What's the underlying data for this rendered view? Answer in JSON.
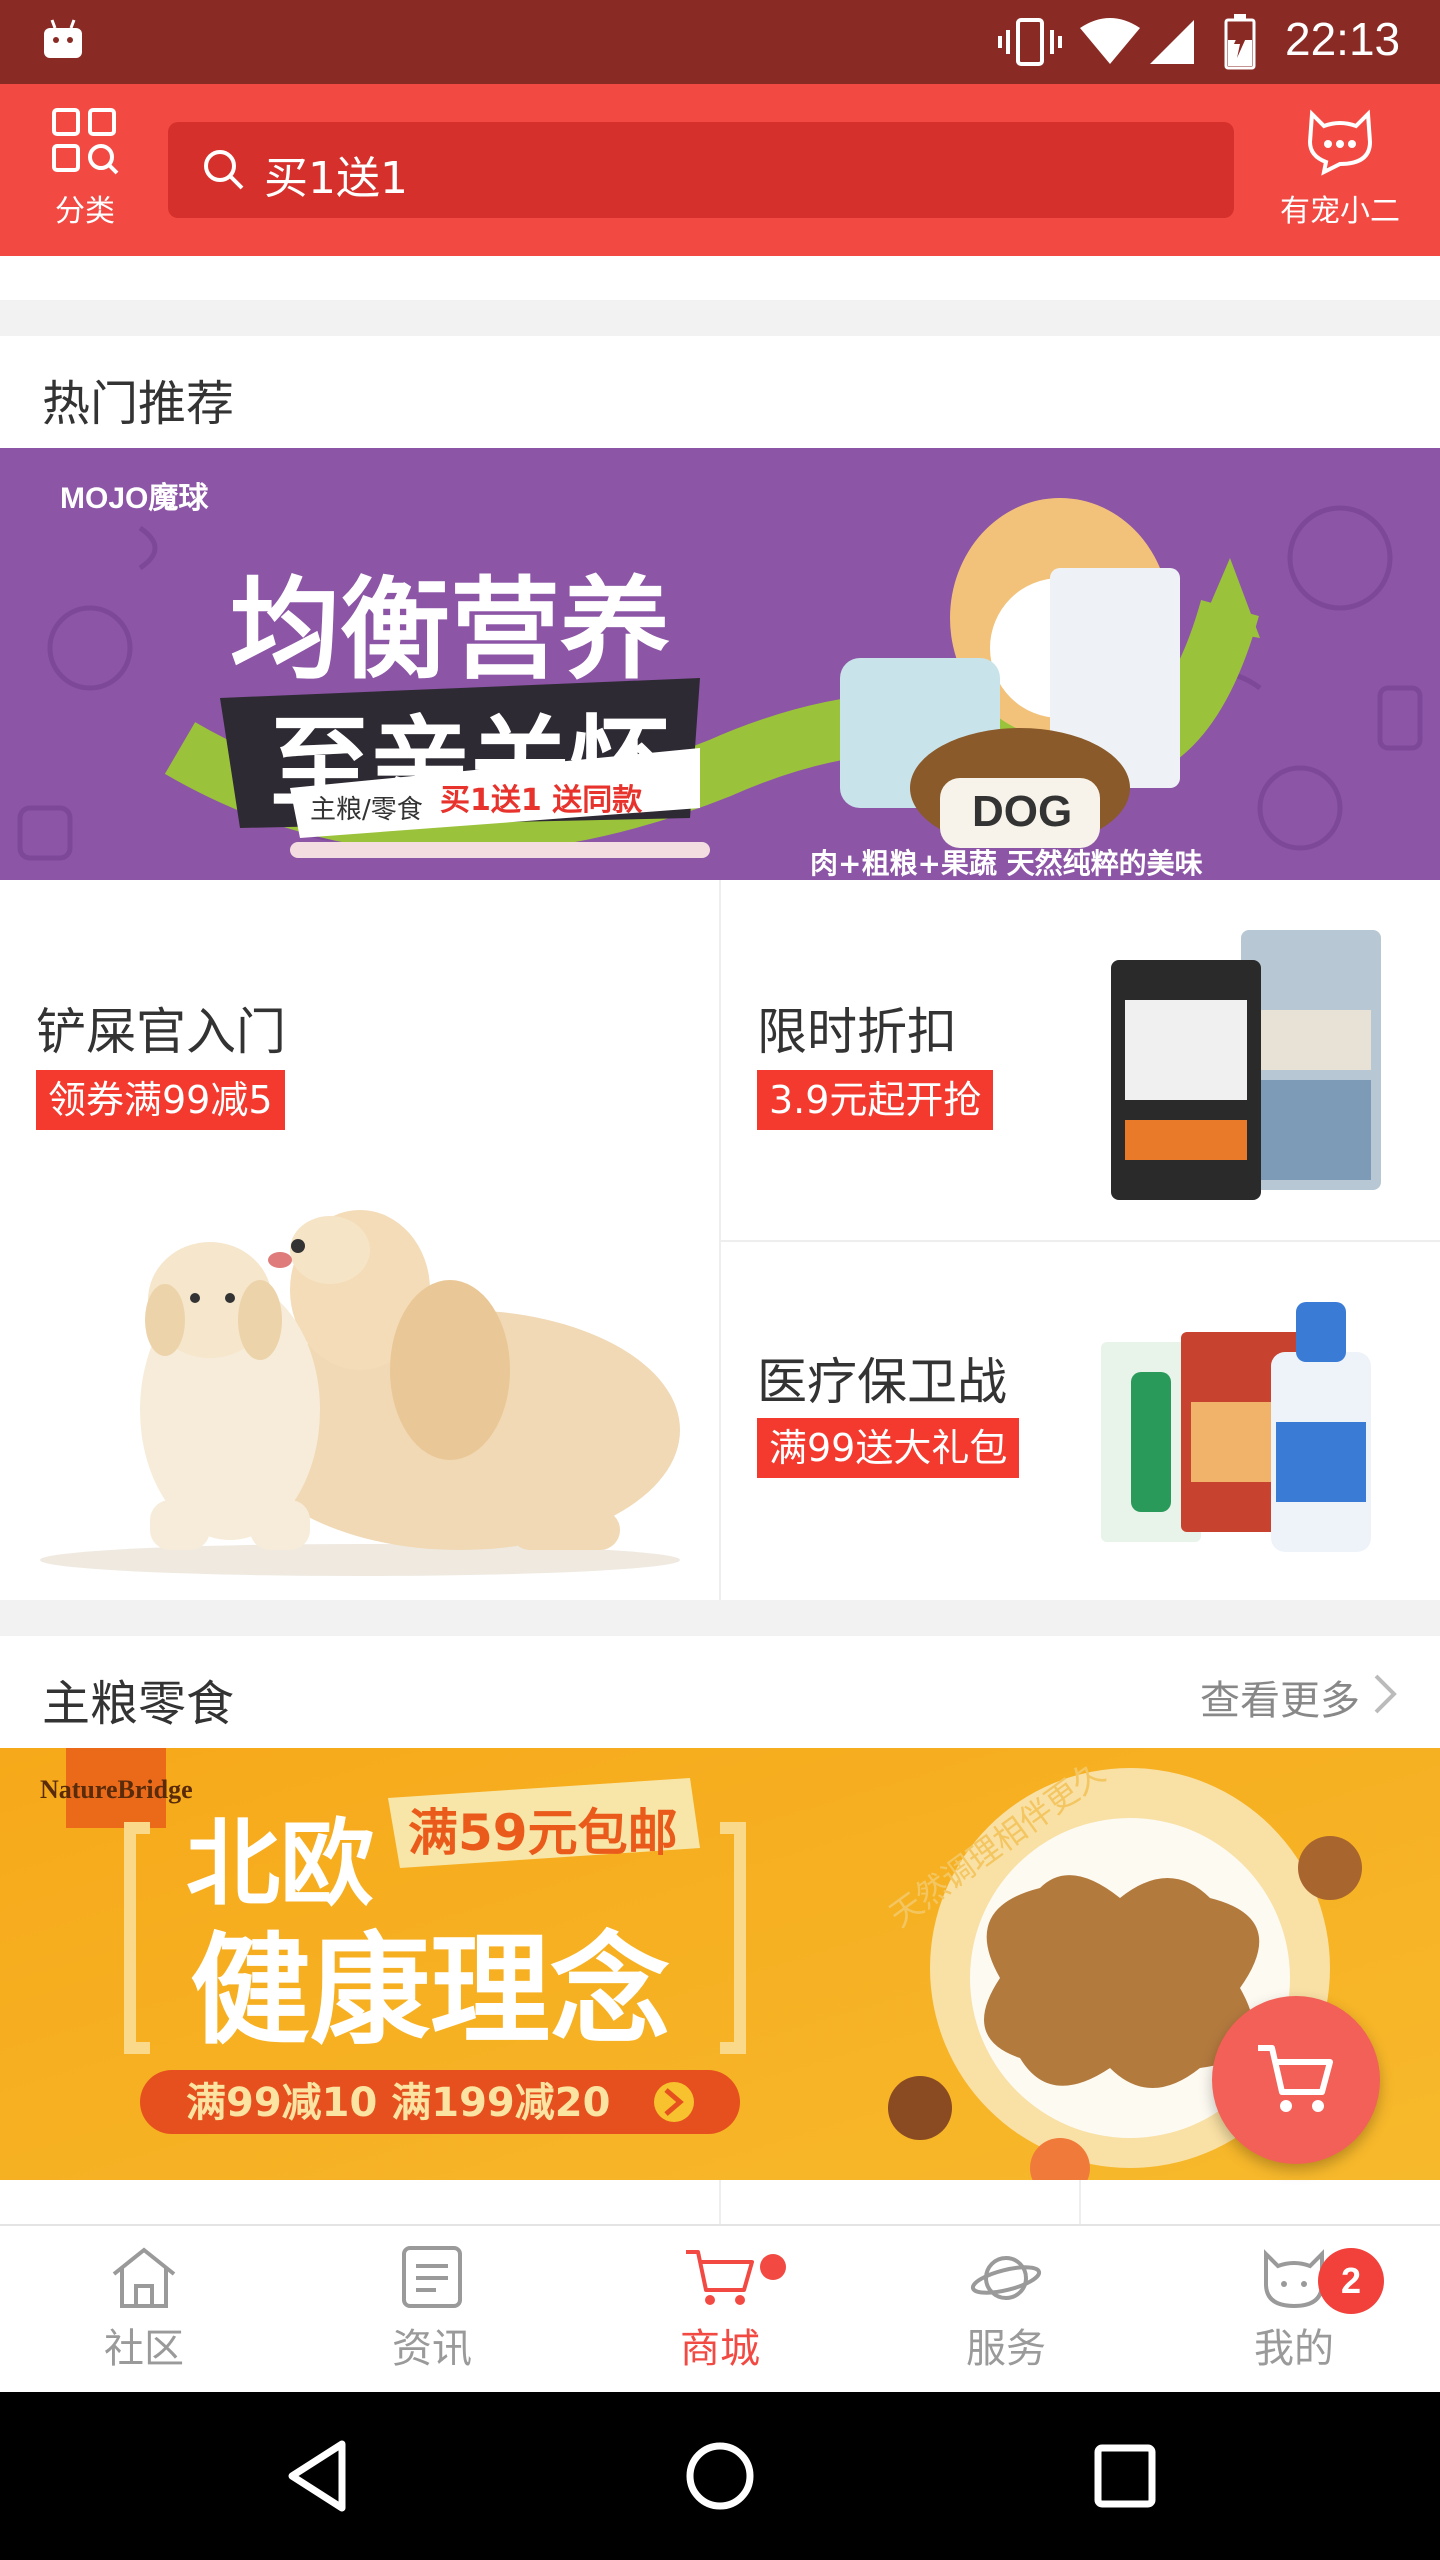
{
  "status_bar": {
    "time": "22:13"
  },
  "header": {
    "category_label": "分类",
    "search_text": "买1送1",
    "service_label": "有宠小二"
  },
  "hot": {
    "title": "热门推荐",
    "banner": {
      "brand": "MOJO魔球",
      "headline1": "均衡营养",
      "headline2": "至亲关怀",
      "promo_prefix": "主粮/零食",
      "promo_highlight": "买1送1 送同款",
      "tagline": "肉+粗粮+果蔬 天然纯粹的美味",
      "package_text": "DOG"
    },
    "tiles": [
      {
        "title": "铲屎官入门",
        "tag": "领券满99减5"
      },
      {
        "title": "限时折扣",
        "tag": "3.9元起开抢"
      },
      {
        "title": "医疗保卫战",
        "tag": "满99送大礼包"
      }
    ]
  },
  "staple": {
    "title": "主粮零食",
    "more": "查看更多",
    "banner": {
      "brand": "NatureBridge",
      "headline1": "北欧",
      "headline2": "健康理念",
      "badge": "满59元包邮",
      "offer": "满99减10  满199减20",
      "slogan": "天然调理相伴更久"
    }
  },
  "bottom_nav": {
    "items": [
      {
        "label": "社区",
        "icon": "home-icon"
      },
      {
        "label": "资讯",
        "icon": "news-icon"
      },
      {
        "label": "商城",
        "icon": "cart-icon"
      },
      {
        "label": "服务",
        "icon": "planet-icon"
      },
      {
        "label": "我的",
        "icon": "cat-face-icon"
      }
    ],
    "active_index": 2,
    "badge_count": "2"
  },
  "colors": {
    "primary": "#f24a43",
    "status_bar": "#8a2a24",
    "tag_red": "#f43a2f"
  }
}
